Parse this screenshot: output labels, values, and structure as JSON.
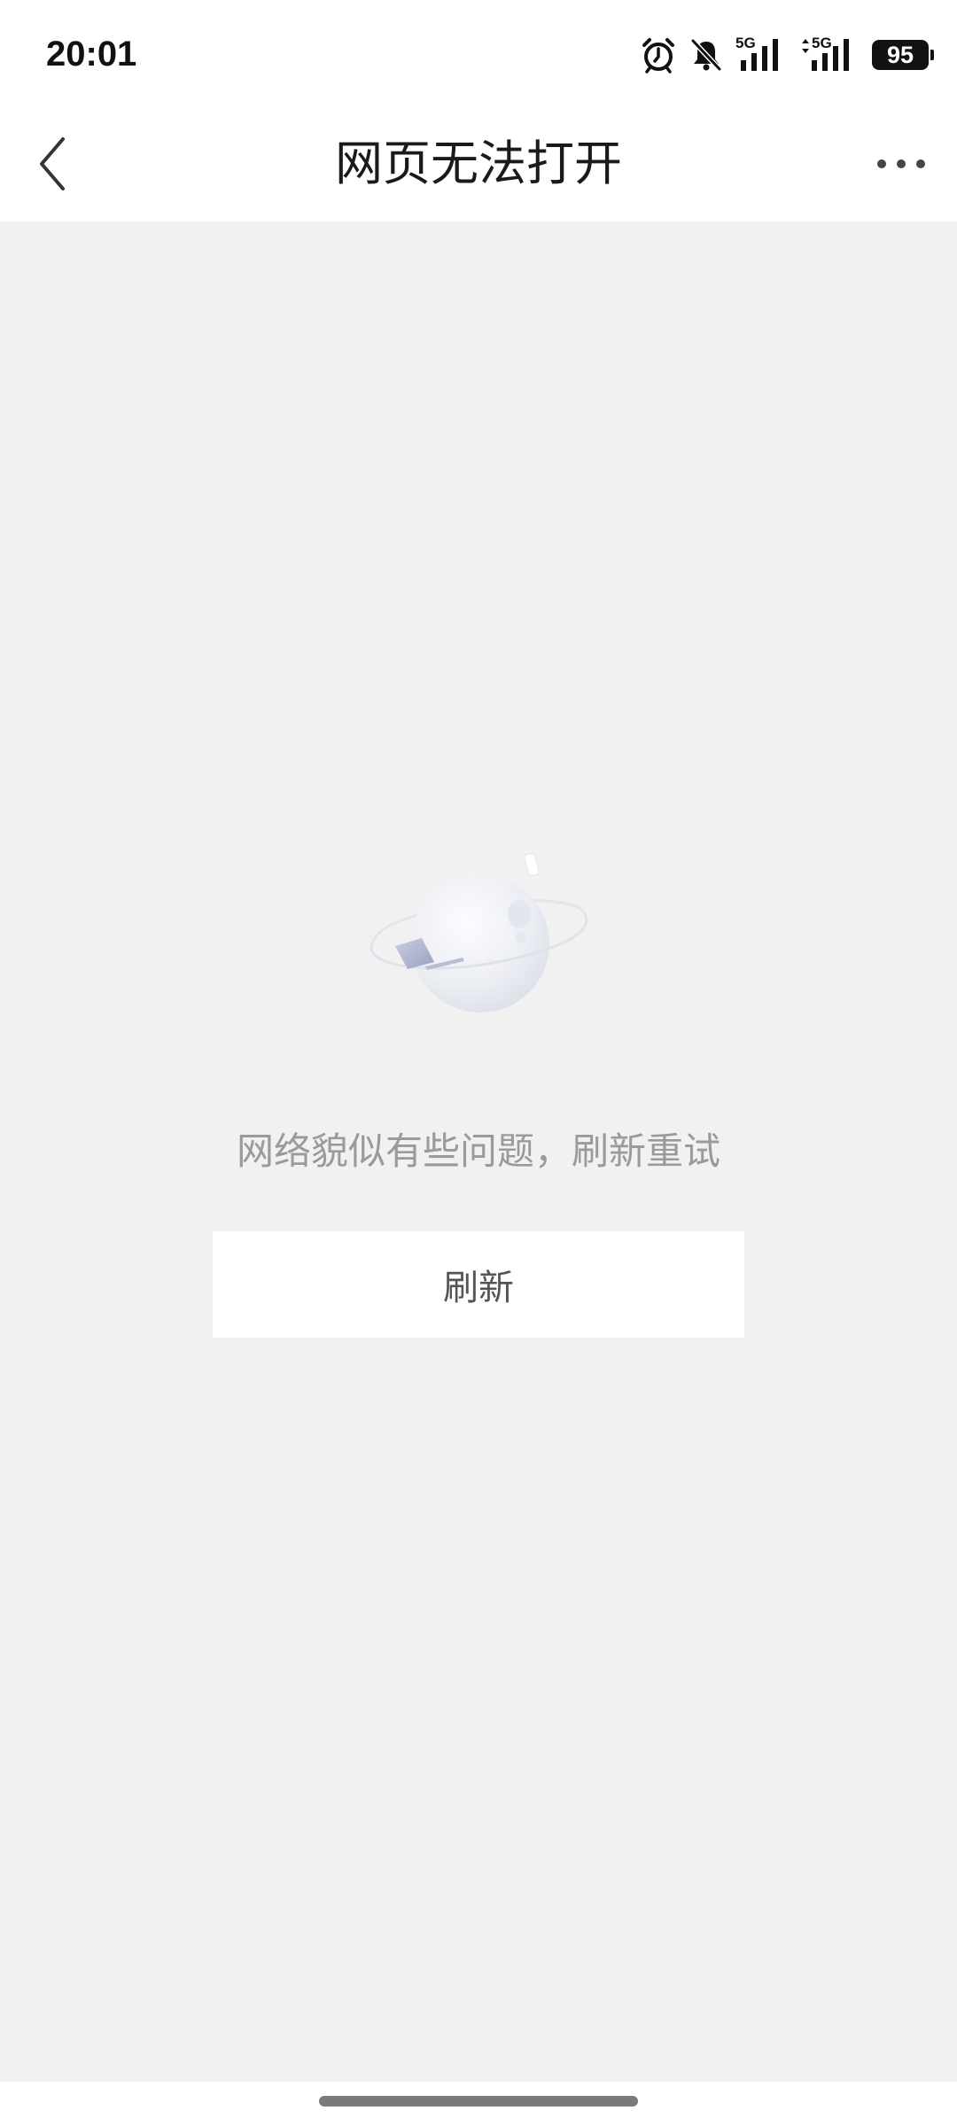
{
  "status_bar": {
    "time": "20:01",
    "sim1_label": "5G",
    "sim2_label": "5G",
    "battery": "95",
    "icons": [
      "alarm-icon",
      "bell-off-icon",
      "signal-icon",
      "signal-icon",
      "battery-icon"
    ]
  },
  "nav": {
    "title": "网页无法打开",
    "back_icon": "chevron-left-icon",
    "more_icon": "more-horizontal-icon"
  },
  "content": {
    "message": "网络貌似有些问题，刷新重试",
    "refresh_label": "刷新",
    "illustration": "planet-illustration"
  },
  "colors": {
    "background": "#f1f1f1",
    "surface": "#ffffff",
    "title_text": "#1a1a1a",
    "message_text": "#9a9a9a",
    "button_text": "#555555"
  }
}
